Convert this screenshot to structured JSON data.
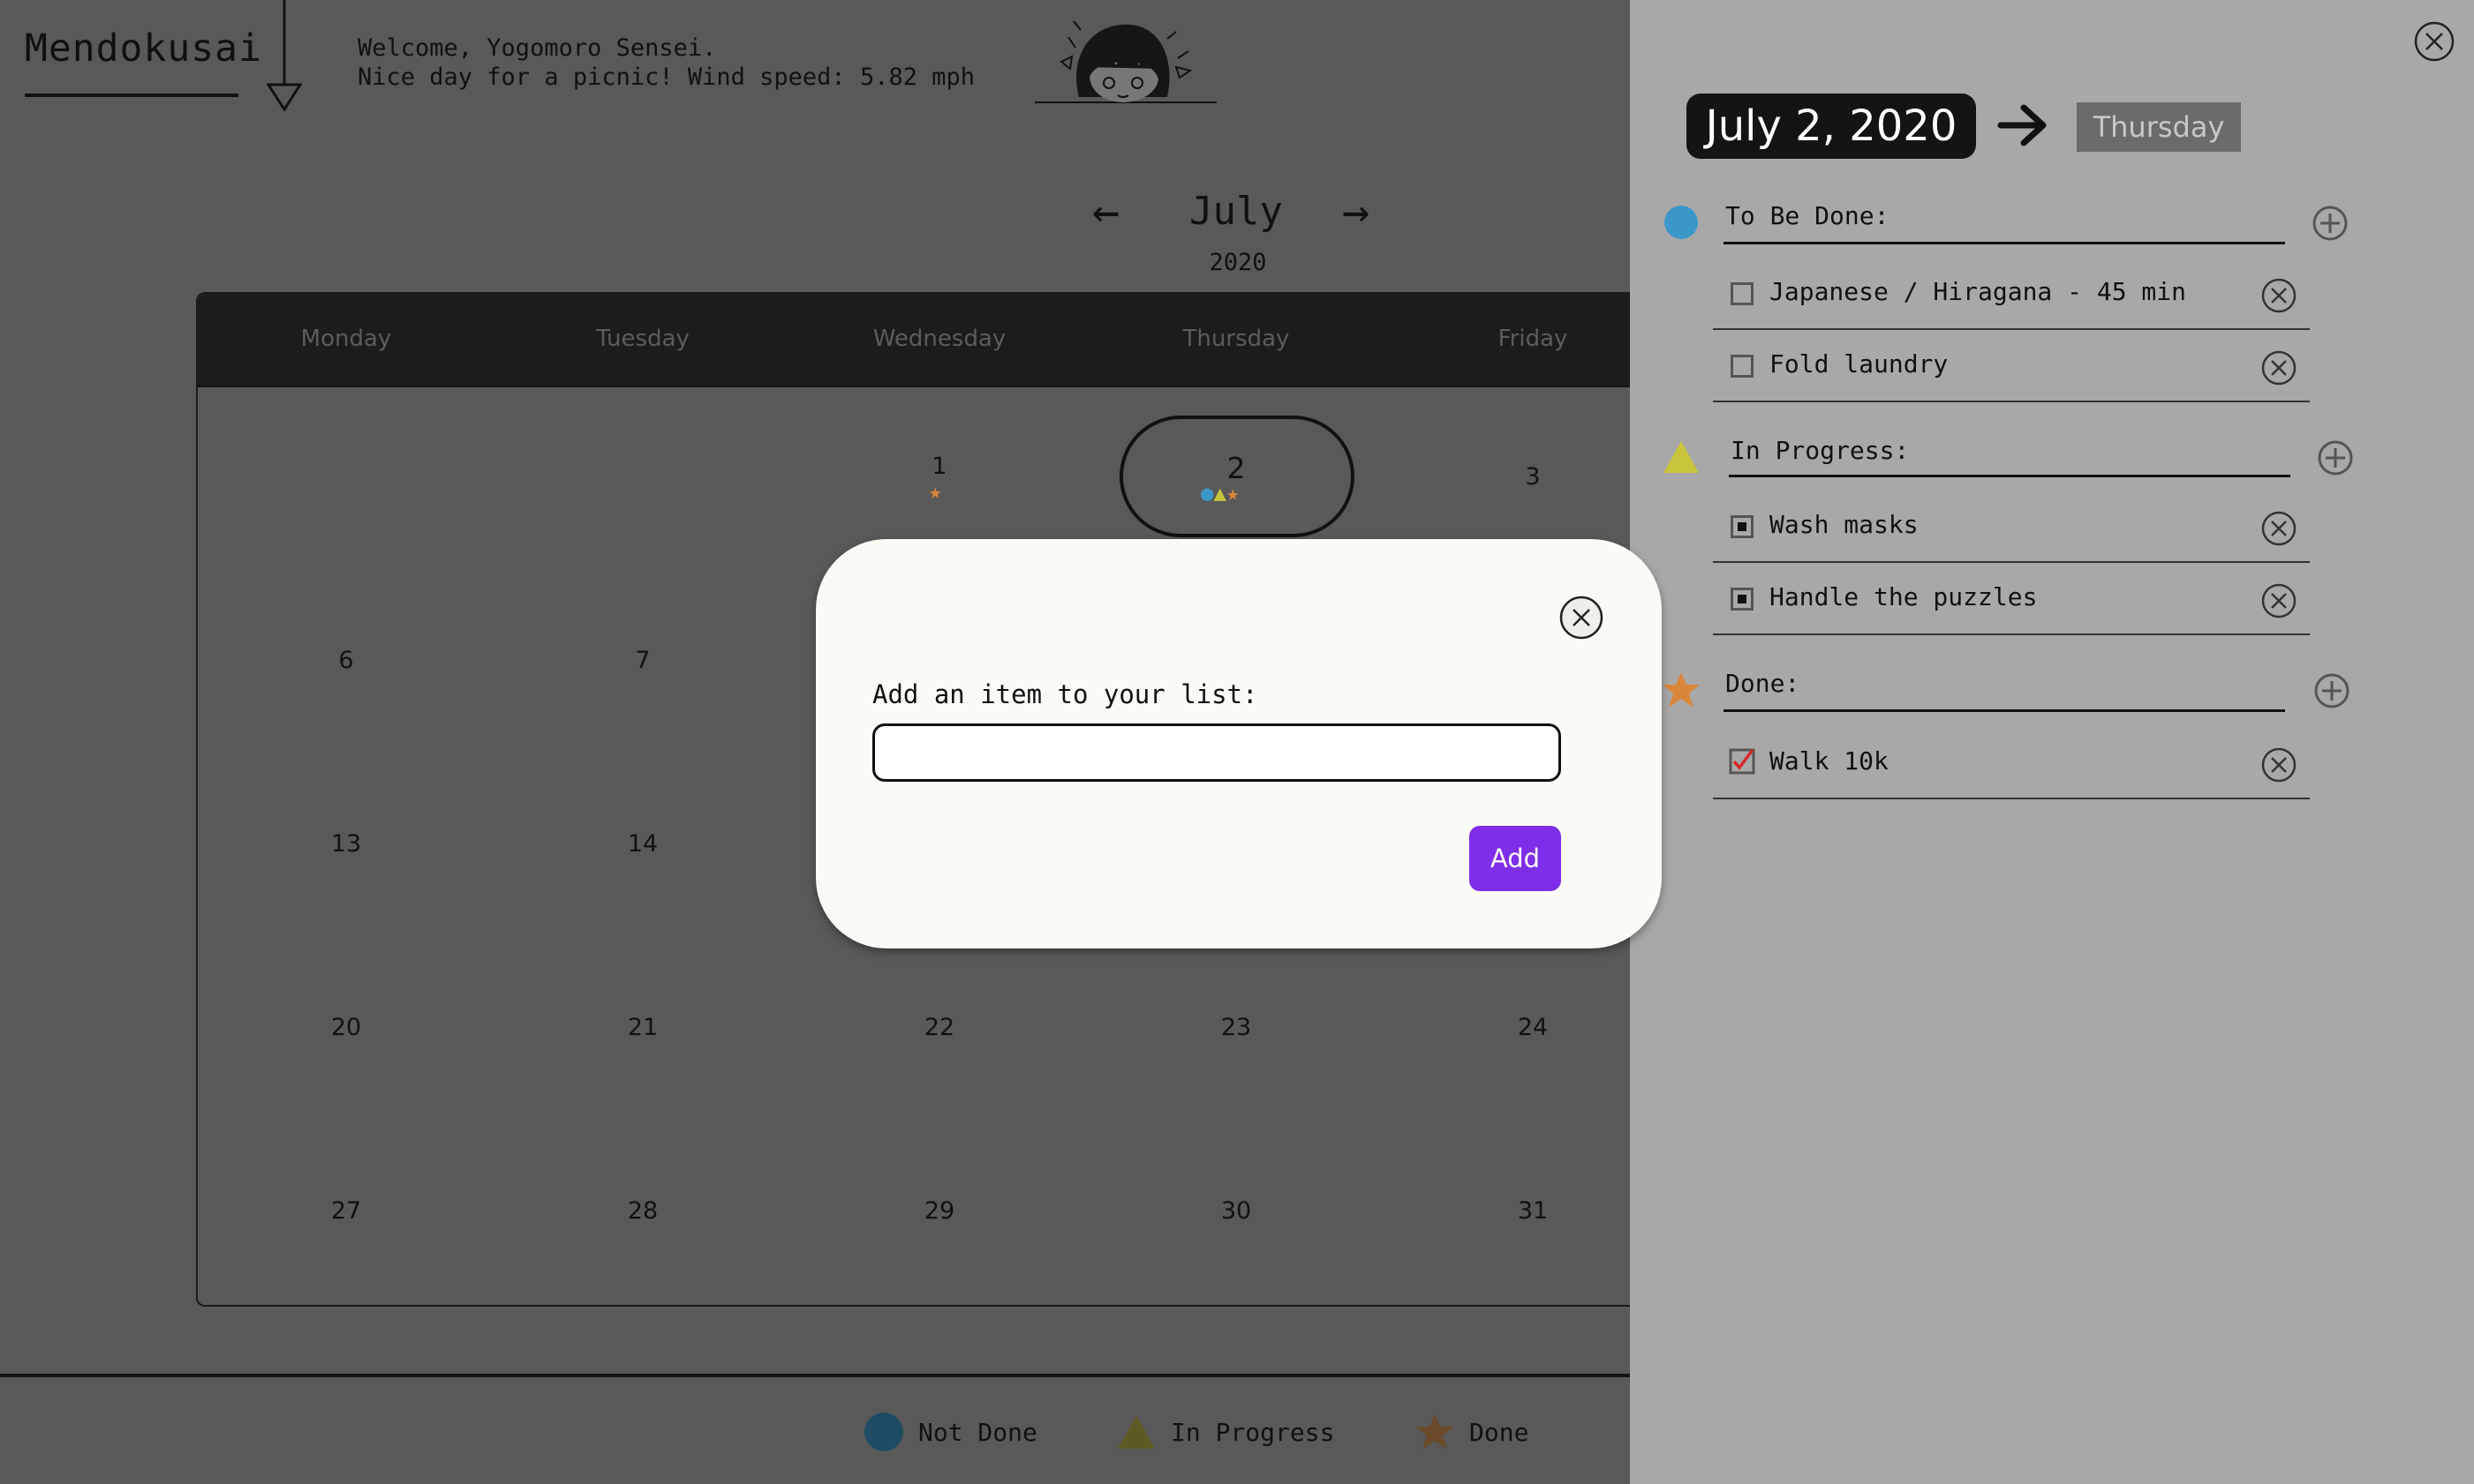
{
  "header": {
    "brand": "Mendokusai",
    "welcome_line1": "Welcome, Yogomoro Sensei.",
    "welcome_line2": "Nice day for a picnic! Wind speed: 5.82 mph"
  },
  "calendar": {
    "month": "July",
    "year": "2020",
    "prev_icon": "←",
    "next_icon": "→",
    "weekdays": [
      "Monday",
      "Tuesday",
      "Wednesday",
      "Thursday",
      "Friday"
    ],
    "days": [
      "1",
      "2",
      "3",
      "6",
      "7",
      "13",
      "14",
      "20",
      "21",
      "22",
      "23",
      "24",
      "27",
      "28",
      "29",
      "30",
      "31"
    ],
    "marks_day1": "★",
    "marks_day2": "●▲★"
  },
  "legend": {
    "not_done": "Not Done",
    "in_progress": "In Progress",
    "done": "Done"
  },
  "panel": {
    "date": "July 2, 2020",
    "weekday": "Thursday",
    "sections": {
      "todo": {
        "title": "To Be Done:",
        "items": [
          "Japanese / Hiragana - 45 min",
          "Fold laundry"
        ]
      },
      "progress": {
        "title": "In Progress:",
        "items": [
          "Wash masks",
          "Handle the puzzles"
        ]
      },
      "done": {
        "title": "Done:",
        "items": [
          "Walk 10k"
        ]
      }
    }
  },
  "modal": {
    "label": "Add an item to your list:",
    "input_value": "",
    "add_button": "Add"
  },
  "colors": {
    "not_done": "#3b97c8",
    "in_progress": "#c8c43c",
    "done": "#d9863a",
    "accent_button": "#7e2de8"
  }
}
